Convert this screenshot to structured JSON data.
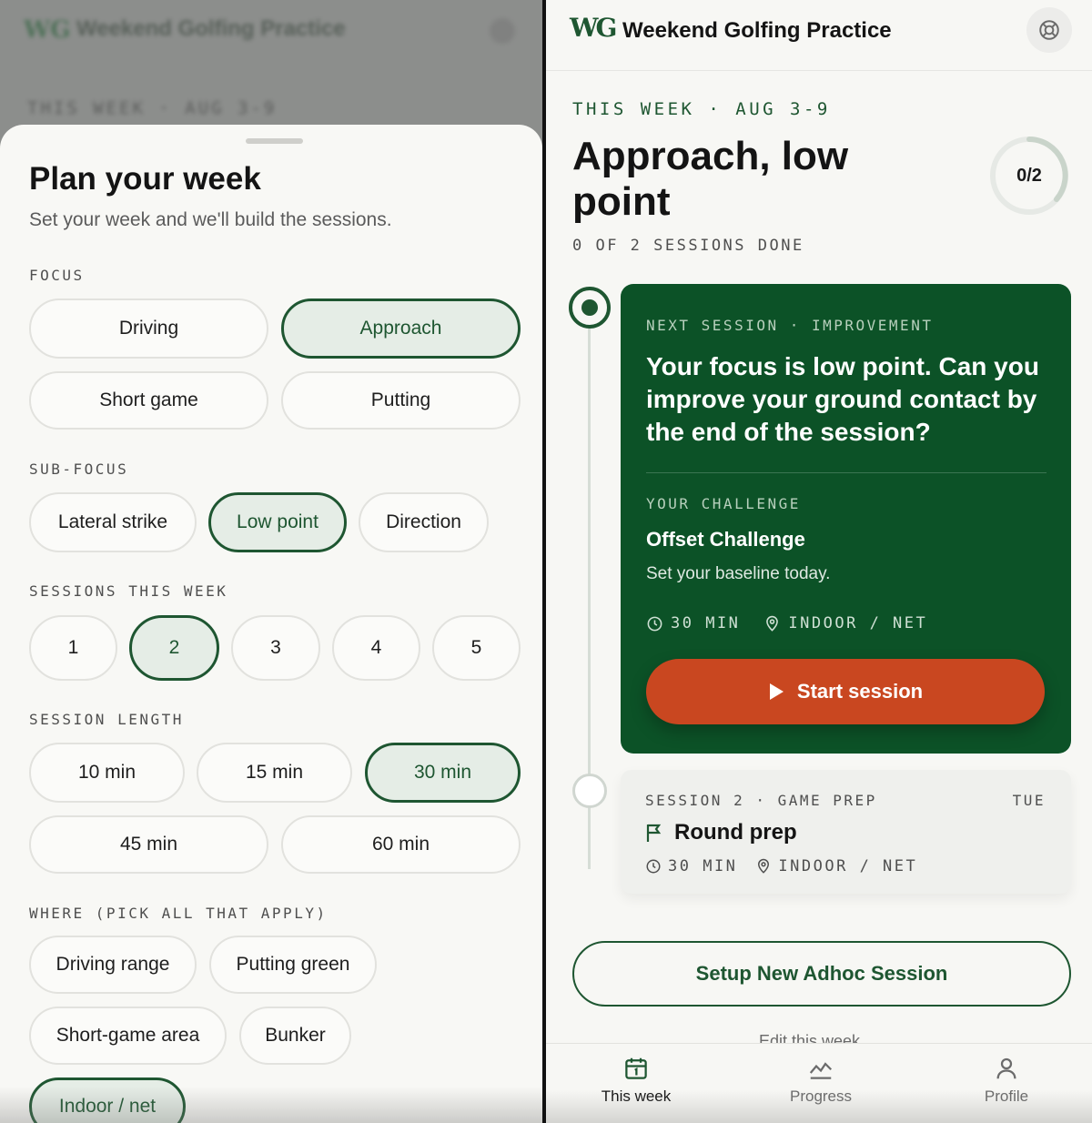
{
  "app": {
    "logo_text": "WG",
    "title": "Weekend Golfing Practice"
  },
  "plan_sheet": {
    "title": "Plan your week",
    "subtitle": "Set your week and we'll build the sessions.",
    "focus": {
      "label": "FOCUS",
      "options": [
        "Driving",
        "Approach",
        "Short game",
        "Putting"
      ],
      "selected": "Approach"
    },
    "sub_focus": {
      "label": "SUB-FOCUS",
      "options": [
        "Lateral strike",
        "Low point",
        "Direction"
      ],
      "selected": "Low point"
    },
    "sessions_this_week": {
      "label": "SESSIONS THIS WEEK",
      "options": [
        "1",
        "2",
        "3",
        "4",
        "5"
      ],
      "selected": "2"
    },
    "session_length": {
      "label": "SESSION LENGTH",
      "options": [
        "10 min",
        "15 min",
        "30 min",
        "45 min",
        "60 min"
      ],
      "selected": "30 min"
    },
    "where": {
      "label": "WHERE (PICK ALL THAT APPLY)",
      "options": [
        "Driving range",
        "Putting green",
        "Short-game area",
        "Bunker",
        "Indoor / net"
      ],
      "selected": [
        "Indoor / net"
      ]
    }
  },
  "week_view": {
    "week_label": "THIS WEEK · AUG 3-9",
    "title": "Approach, low point",
    "sessions_done": "0 OF 2 SESSIONS DONE",
    "progress": {
      "text": "0/2",
      "done": 0,
      "total": 2
    },
    "next_session": {
      "label": "NEXT SESSION · IMPROVEMENT",
      "question": "Your focus is low point. Can you improve your ground contact by the end of the session?",
      "challenge_label": "YOUR CHALLENGE",
      "challenge_name": "Offset Challenge",
      "challenge_desc": "Set your baseline today.",
      "duration": "30 MIN",
      "location": "INDOOR / NET",
      "start_label": "Start session"
    },
    "session_2": {
      "label": "SESSION 2 · GAME PREP",
      "day": "TUE",
      "title": "Round prep",
      "duration": "30 MIN",
      "location": "INDOOR / NET"
    },
    "adhoc_label": "Setup New Adhoc Session",
    "edit_week_label": "Edit this week"
  },
  "tabbar": {
    "tabs": [
      {
        "label": "This week",
        "icon": "calendar-icon",
        "active": true
      },
      {
        "label": "Progress",
        "icon": "progress-chart-icon",
        "active": false
      },
      {
        "label": "Profile",
        "icon": "person-icon",
        "active": false
      }
    ]
  },
  "colors": {
    "brand_green": "#1e5631",
    "card_green": "#0c5227",
    "accent_orange": "#c94720"
  }
}
